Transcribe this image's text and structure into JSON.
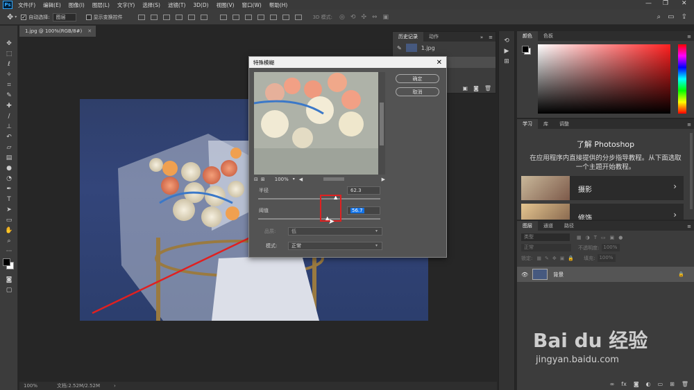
{
  "menu": {
    "logo": "Ps",
    "items": [
      "文件(F)",
      "编辑(E)",
      "图像(I)",
      "图层(L)",
      "文字(Y)",
      "选择(S)",
      "滤镜(T)",
      "3D(D)",
      "视图(V)",
      "窗口(W)",
      "帮助(H)"
    ]
  },
  "options": {
    "auto_select_label": "自动选择:",
    "auto_select_value": "图层",
    "show_transform_label": "显示变换控件",
    "mode_3d_label": "3D 模式:"
  },
  "document": {
    "tab_title": "1.jpg @ 100%(RGB/8#)",
    "zoom": "100%",
    "doc_size": "文档:2.52M/2.52M"
  },
  "history_panel": {
    "tabs": [
      "历史记录",
      "动作"
    ],
    "snapshot_label": "1.jpg"
  },
  "dialog": {
    "title": "特殊模糊",
    "ok_label": "确定",
    "cancel_label": "取消",
    "preview_zoom": "100%",
    "radius_label": "半径",
    "radius_value": "62.3",
    "threshold_label": "阈值",
    "threshold_value": "56.7",
    "quality_label": "品质:",
    "quality_value": "低",
    "mode_label": "模式:",
    "mode_value": "正常"
  },
  "color_panel": {
    "tabs": [
      "颜色",
      "色板"
    ],
    "base_hue_color": "#ff2020"
  },
  "learn_panel": {
    "tabs": [
      "学习",
      "库",
      "调整"
    ],
    "heading": "了解 Photoshop",
    "description": "在应用程序内直接提供的分步指导教程。从下面选取一个主题开始教程。",
    "topics": [
      "摄影",
      "修饰"
    ]
  },
  "layers_panel": {
    "tabs": [
      "图层",
      "通道",
      "路径"
    ],
    "filter_placeholder": "类型",
    "blend_mode": "正常",
    "opacity_label": "不透明度:",
    "opacity_value": "100%",
    "lock_label": "锁定:",
    "fill_label": "填充:",
    "fill_value": "100%",
    "layer_name": "背景"
  },
  "watermark": {
    "brand": "Bai du 经验",
    "url": "jingyan.baidu.com"
  },
  "colors": {
    "annotation_red": "#e02020",
    "selection_blue": "#1473e6"
  }
}
